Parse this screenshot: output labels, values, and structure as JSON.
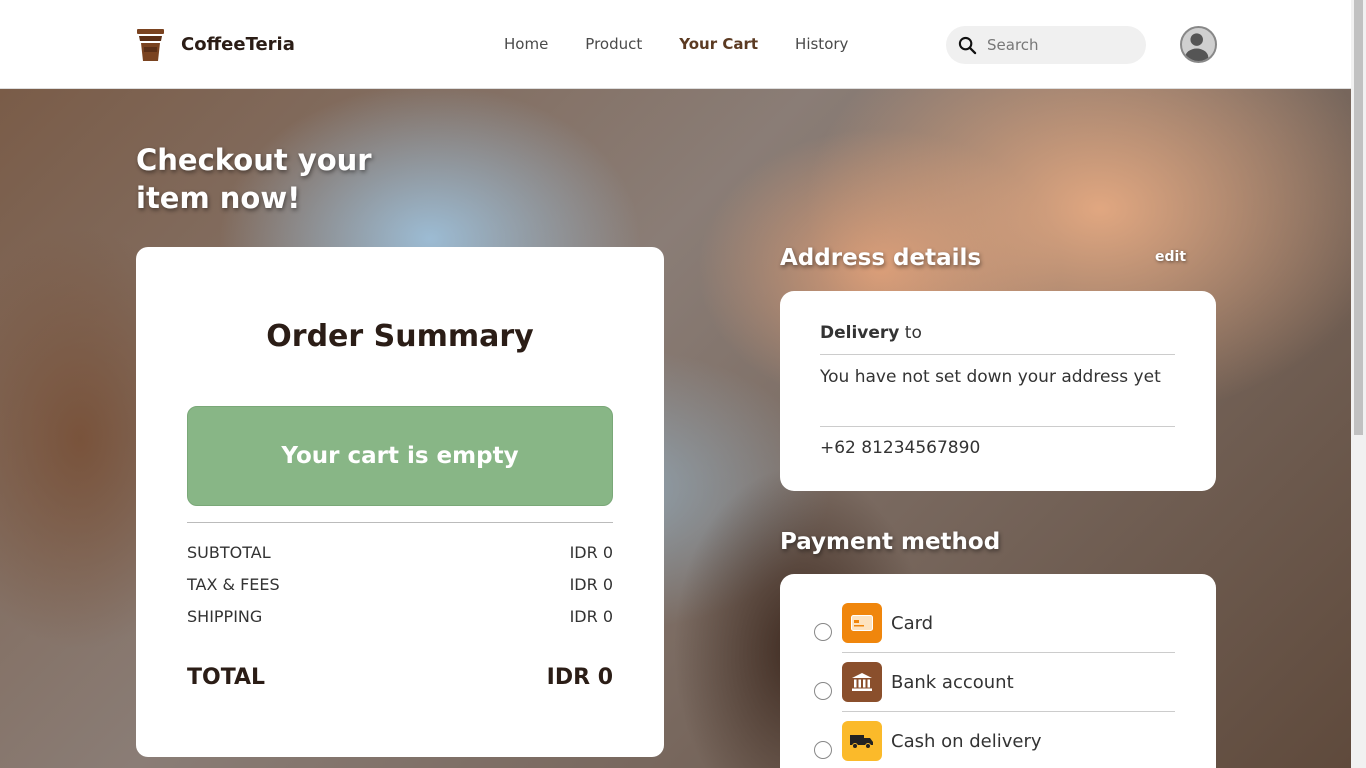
{
  "brand": {
    "name": "CoffeeTeria",
    "logo_icon": "coffee-cup-icon"
  },
  "nav": [
    {
      "label": "Home",
      "active": false
    },
    {
      "label": "Product",
      "active": false
    },
    {
      "label": "Your Cart",
      "active": true
    },
    {
      "label": "History",
      "active": false
    }
  ],
  "search": {
    "placeholder": "Search",
    "icon": "search-icon"
  },
  "user": {
    "icon": "user-avatar-icon"
  },
  "hero": {
    "title": "Checkout your item now!"
  },
  "summary": {
    "title": "Order Summary",
    "empty_message": "Your cart is empty",
    "rows": [
      {
        "label": "SUBTOTAL",
        "value": "IDR 0"
      },
      {
        "label": "TAX & FEES",
        "value": "IDR 0"
      },
      {
        "label": "SHIPPING",
        "value": "IDR 0"
      }
    ],
    "total": {
      "label": "TOTAL",
      "value": "IDR 0"
    }
  },
  "address": {
    "title": "Address details",
    "edit_label": "edit",
    "delivery_bold": "Delivery",
    "delivery_rest": " to",
    "address_text": "You have not set down your address yet",
    "phone": "+62 81234567890"
  },
  "payment": {
    "title": "Payment method",
    "methods": [
      {
        "label": "Card",
        "icon": "card-icon",
        "color": "#f0860c"
      },
      {
        "label": "Bank account",
        "icon": "bank-icon",
        "color": "#8a4f2c"
      },
      {
        "label": "Cash on delivery",
        "icon": "delivery-truck-icon",
        "color": "#fbba2a"
      }
    ]
  }
}
